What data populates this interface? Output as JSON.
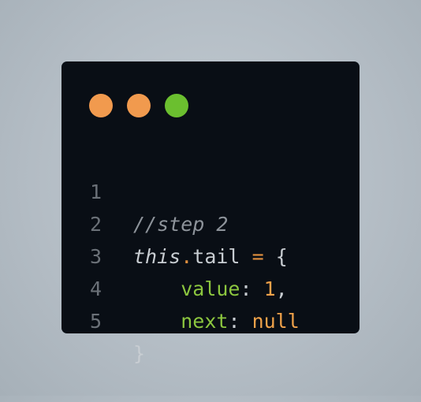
{
  "window": {
    "dots": [
      {
        "name": "close",
        "color": "#f19a4e"
      },
      {
        "name": "minimize",
        "color": "#f19a4e"
      },
      {
        "name": "maximize",
        "color": "#6bbf2f"
      }
    ]
  },
  "code": {
    "lines": [
      {
        "number": "1",
        "comment": "//step 2"
      },
      {
        "number": "2",
        "kw": "this",
        "dot": ".",
        "prop": "tail",
        "eq": "=",
        "brace": "{"
      },
      {
        "number": "3",
        "indent": "    ",
        "key": "value",
        "colon": ":",
        "value": "1",
        "comma": ","
      },
      {
        "number": "4",
        "indent": "    ",
        "key": "next",
        "colon": ":",
        "value": "null"
      },
      {
        "number": "5",
        "brace": "}"
      }
    ]
  }
}
